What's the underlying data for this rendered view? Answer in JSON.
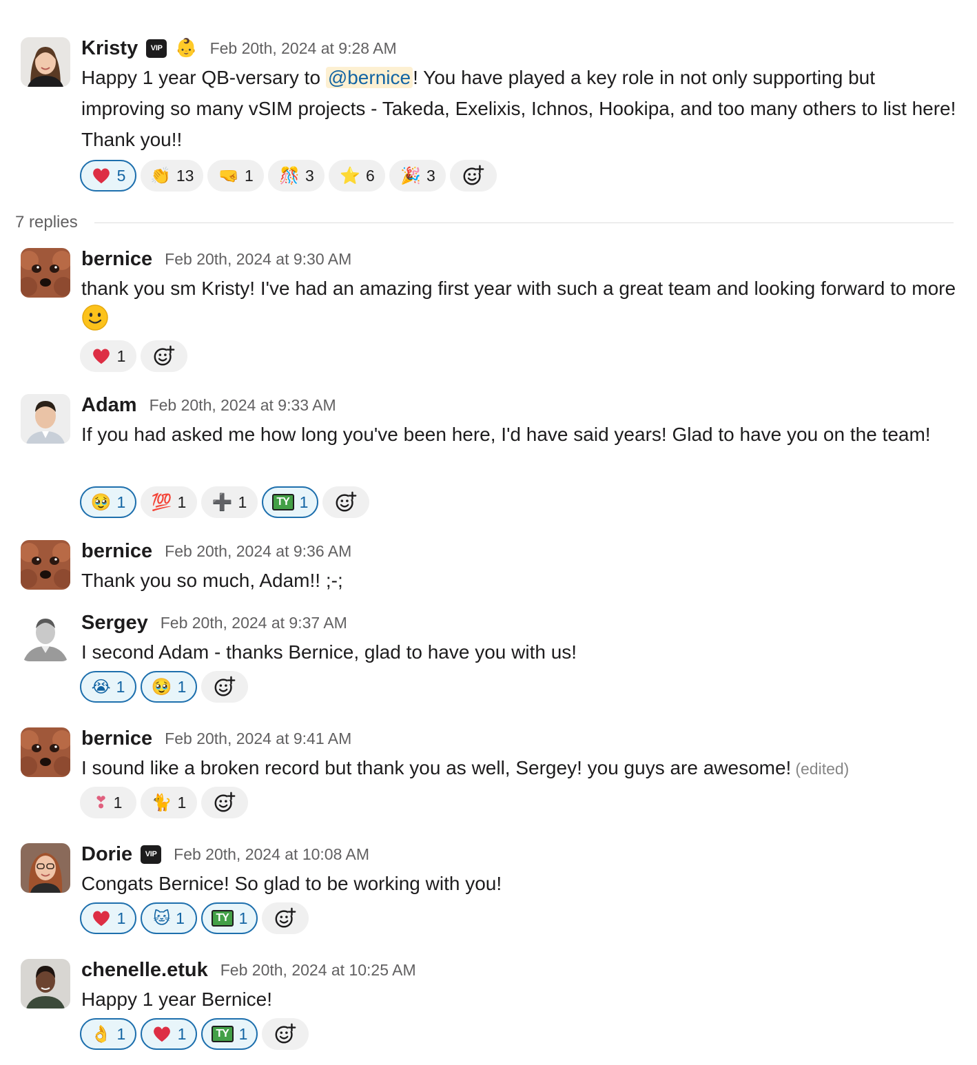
{
  "parent": {
    "author": "Kristy",
    "vip_badge": "VIP",
    "status_emoji": "👶",
    "timestamp": "Feb 20th, 2024 at 9:28 AM",
    "text_before": "Happy 1 year QB-versary to ",
    "mention": "@bernice",
    "text_after": "! You have played a key role in not only supporting but improving so many vSIM projects - Takeda, Exelixis, Ichnos, Hookipa, and too many others to list here! Thank you!!",
    "reactions": [
      {
        "emoji": "❤️",
        "count": "5"
      },
      {
        "emoji": "👏",
        "count": "13"
      },
      {
        "emoji": "🤜",
        "count": "1"
      },
      {
        "emoji": "🎊",
        "count": "3"
      },
      {
        "emoji": "⭐",
        "count": "6"
      },
      {
        "emoji": "🎉",
        "count": "3"
      }
    ]
  },
  "replies_label": "7 replies",
  "replies": [
    {
      "author": "bernice",
      "timestamp": "Feb 20th, 2024 at 9:30 AM",
      "text": "thank you sm Kristy! I've had an amazing first year with such a great team and looking forward to more",
      "inline_emoji": "🙂",
      "reactions": [
        {
          "emoji": "❤️",
          "count": "1"
        }
      ]
    },
    {
      "author": "Adam",
      "timestamp": "Feb 20th, 2024 at 9:33 AM",
      "text": "If you had asked me how long you've been here, I'd have said years! Glad to have you on the team!",
      "reactions": [
        {
          "emoji": "🥹",
          "count": "1"
        },
        {
          "emoji": "💯",
          "count": "1"
        },
        {
          "emoji": "➕",
          "count": "1"
        },
        {
          "emoji": "TY",
          "count": "1"
        }
      ]
    },
    {
      "author": "bernice",
      "timestamp": "Feb 20th, 2024 at 9:36 AM",
      "text": "Thank you so much, Adam!! ;-;"
    },
    {
      "author": "Sergey",
      "timestamp": "Feb 20th, 2024 at 9:37 AM",
      "text": "I second Adam - thanks Bernice, glad to have you with us!",
      "reactions": [
        {
          "emoji": "😭",
          "count": "1"
        },
        {
          "emoji": "🥹",
          "count": "1"
        }
      ]
    },
    {
      "author": "bernice",
      "timestamp": "Feb 20th, 2024 at 9:41 AM",
      "text": "I sound like a broken record but thank you as well, Sergey! you guys are awesome!",
      "edited": "(edited)",
      "reactions": [
        {
          "emoji": "❣",
          "count": "1"
        },
        {
          "emoji": "🐈",
          "count": "1"
        }
      ]
    },
    {
      "author": "Dorie",
      "vip_badge": "VIP",
      "timestamp": "Feb 20th, 2024 at 10:08 AM",
      "text": "Congats Bernice! So glad to be working with you!",
      "reactions": [
        {
          "emoji": "❤️",
          "count": "1"
        },
        {
          "emoji": "🐱",
          "count": "1"
        },
        {
          "emoji": "TY",
          "count": "1"
        }
      ]
    },
    {
      "author": "chenelle.etuk",
      "timestamp": "Feb 20th, 2024 at 10:25 AM",
      "text": "Happy 1 year Bernice!",
      "reactions": [
        {
          "emoji": "👌",
          "count": "1"
        },
        {
          "emoji": "❤️",
          "count": "1"
        },
        {
          "emoji": "TY",
          "count": "1"
        }
      ]
    }
  ]
}
